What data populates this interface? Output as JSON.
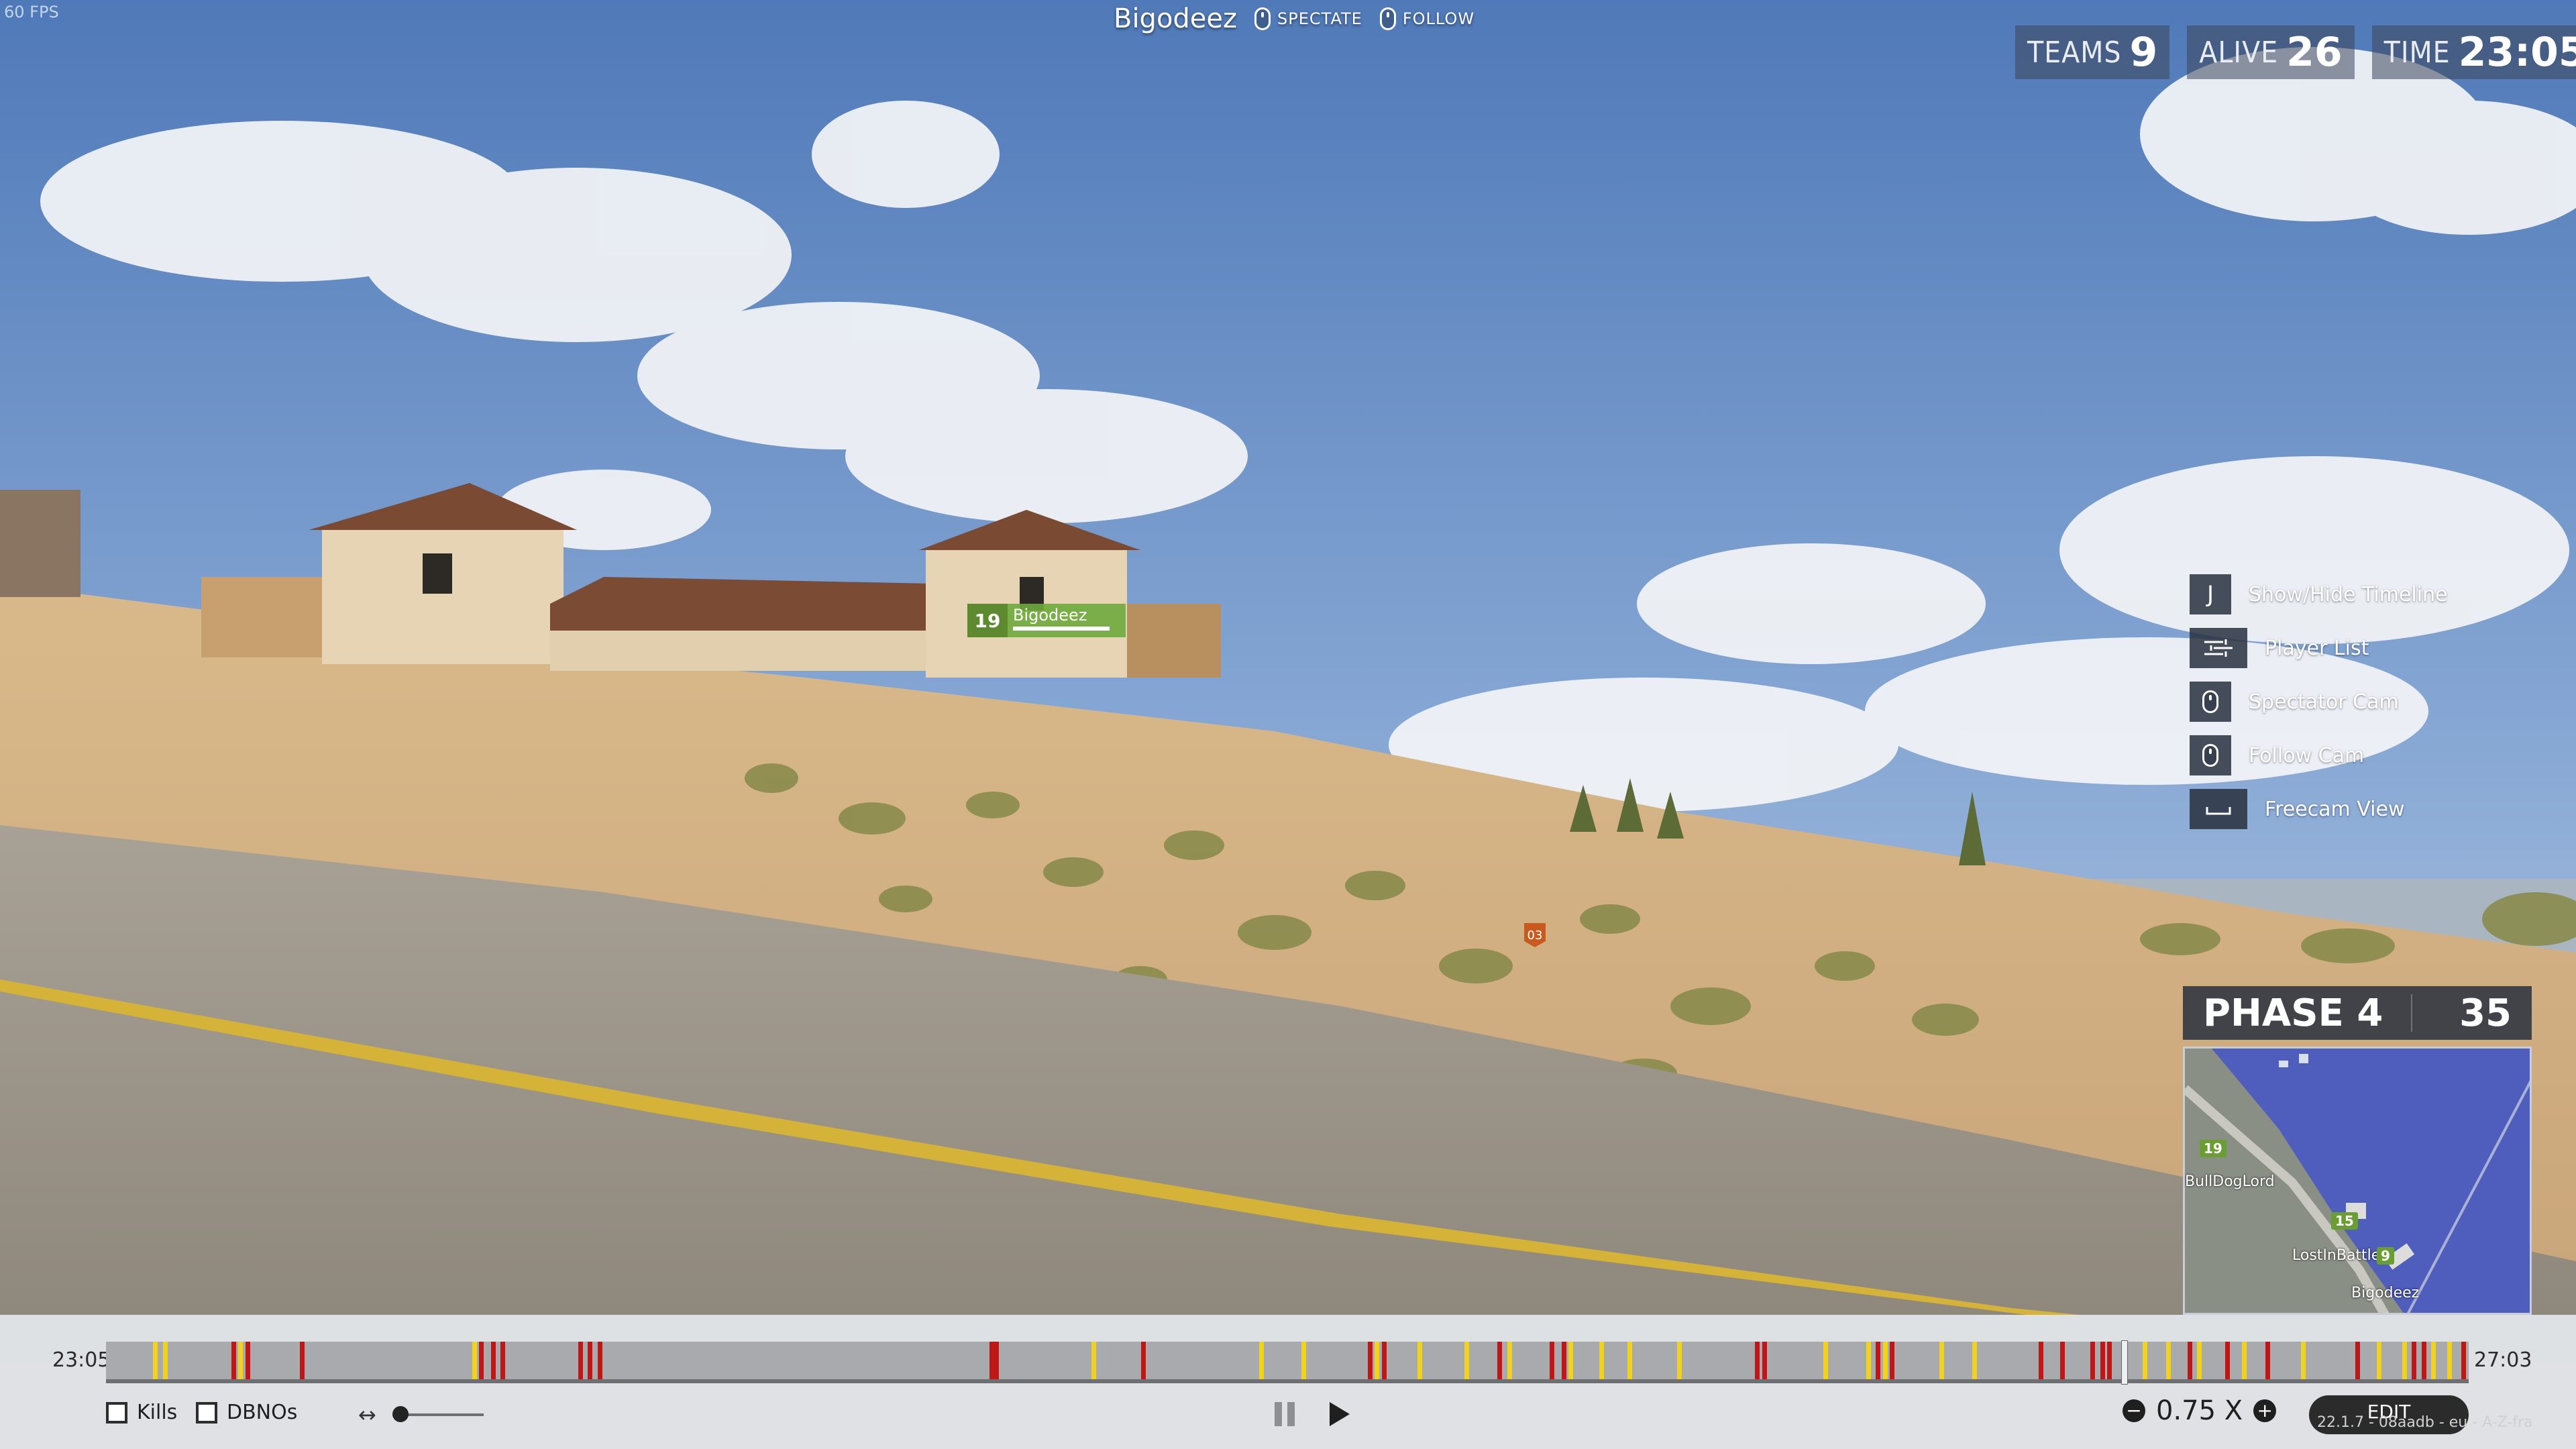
{
  "hud": {
    "fps": "60 FPS",
    "player_name": "Bigodeez",
    "spectate_label": "SPECTATE",
    "follow_label": "FOLLOW"
  },
  "stats": {
    "teams_label": "TEAMS",
    "teams_value": "9",
    "alive_label": "ALIVE",
    "alive_value": "26",
    "time_label": "TIME",
    "time_value": "23:05"
  },
  "hotkeys": [
    {
      "key": "J",
      "icon": "j-key-icon",
      "label": "Show/Hide Timeline"
    },
    {
      "key": "",
      "icon": "player-list-icon",
      "label": "Player List"
    },
    {
      "key": "",
      "icon": "mouse-icon",
      "label": "Spectator Cam"
    },
    {
      "key": "",
      "icon": "mouse-icon",
      "label": "Follow Cam"
    },
    {
      "key": "",
      "icon": "spacebar-icon",
      "label": "Freecam View"
    }
  ],
  "phase": {
    "label": "PHASE 4",
    "count": "35"
  },
  "minimap": {
    "players": [
      {
        "badge": "19"
      },
      {
        "name": "BullDogLord"
      },
      {
        "badge": "15"
      },
      {
        "name": "LostInBattle",
        "badge": "9"
      },
      {
        "name": "Bigodeez"
      }
    ]
  },
  "nametag": {
    "number": "19",
    "name": "Bigodeez",
    "health": 0.9
  },
  "world_marker": "03",
  "timeline": {
    "start": "23:05",
    "end": "27:03",
    "position": 0.853,
    "events": [
      {
        "t": 0.02,
        "c": "yellow"
      },
      {
        "t": 0.024,
        "c": "yellow"
      },
      {
        "t": 0.053,
        "c": "red"
      },
      {
        "t": 0.056,
        "c": "yellow"
      },
      {
        "t": 0.059,
        "c": "red"
      },
      {
        "t": 0.082,
        "c": "red"
      },
      {
        "t": 0.155,
        "c": "yellow"
      },
      {
        "t": 0.158,
        "c": "red"
      },
      {
        "t": 0.163,
        "c": "red"
      },
      {
        "t": 0.167,
        "c": "red"
      },
      {
        "t": 0.2,
        "c": "red"
      },
      {
        "t": 0.204,
        "c": "red"
      },
      {
        "t": 0.208,
        "c": "red"
      },
      {
        "t": 0.374,
        "c": "red"
      },
      {
        "t": 0.376,
        "c": "red"
      },
      {
        "t": 0.417,
        "c": "yellow"
      },
      {
        "t": 0.438,
        "c": "red"
      },
      {
        "t": 0.488,
        "c": "yellow"
      },
      {
        "t": 0.506,
        "c": "yellow"
      },
      {
        "t": 0.534,
        "c": "red"
      },
      {
        "t": 0.537,
        "c": "yellow"
      },
      {
        "t": 0.54,
        "c": "red"
      },
      {
        "t": 0.555,
        "c": "yellow"
      },
      {
        "t": 0.575,
        "c": "yellow"
      },
      {
        "t": 0.589,
        "c": "red"
      },
      {
        "t": 0.593,
        "c": "yellow"
      },
      {
        "t": 0.611,
        "c": "red"
      },
      {
        "t": 0.616,
        "c": "red"
      },
      {
        "t": 0.619,
        "c": "yellow"
      },
      {
        "t": 0.632,
        "c": "yellow"
      },
      {
        "t": 0.644,
        "c": "yellow"
      },
      {
        "t": 0.665,
        "c": "yellow"
      },
      {
        "t": 0.698,
        "c": "red"
      },
      {
        "t": 0.701,
        "c": "red"
      },
      {
        "t": 0.727,
        "c": "yellow"
      },
      {
        "t": 0.745,
        "c": "yellow"
      },
      {
        "t": 0.749,
        "c": "red"
      },
      {
        "t": 0.752,
        "c": "yellow"
      },
      {
        "t": 0.755,
        "c": "red"
      },
      {
        "t": 0.776,
        "c": "yellow"
      },
      {
        "t": 0.79,
        "c": "yellow"
      },
      {
        "t": 0.818,
        "c": "red"
      },
      {
        "t": 0.827,
        "c": "red"
      },
      {
        "t": 0.84,
        "c": "red"
      },
      {
        "t": 0.844,
        "c": "red"
      },
      {
        "t": 0.847,
        "c": "red"
      },
      {
        "t": 0.862,
        "c": "yellow"
      },
      {
        "t": 0.872,
        "c": "yellow"
      },
      {
        "t": 0.881,
        "c": "red"
      },
      {
        "t": 0.885,
        "c": "yellow"
      },
      {
        "t": 0.897,
        "c": "red"
      },
      {
        "t": 0.904,
        "c": "yellow"
      },
      {
        "t": 0.914,
        "c": "red"
      },
      {
        "t": 0.929,
        "c": "yellow"
      },
      {
        "t": 0.952,
        "c": "red"
      },
      {
        "t": 0.961,
        "c": "yellow"
      },
      {
        "t": 0.972,
        "c": "yellow"
      },
      {
        "t": 0.976,
        "c": "red"
      },
      {
        "t": 0.98,
        "c": "red"
      },
      {
        "t": 0.984,
        "c": "yellow"
      },
      {
        "t": 0.991,
        "c": "yellow"
      },
      {
        "t": 0.997,
        "c": "red"
      }
    ],
    "colors": {
      "yellow": "#f2d21a",
      "red": "#c01616"
    }
  },
  "controls": {
    "kills_label": "Kills",
    "dbnos_label": "DBNOs",
    "zoom_icon": "horizontal-arrows-icon",
    "zoom_level": 0,
    "speed": "0.75 X",
    "edit_label": "EDIT",
    "version": "22.1.7 - 08aadb - eu - A-Z-fra"
  }
}
